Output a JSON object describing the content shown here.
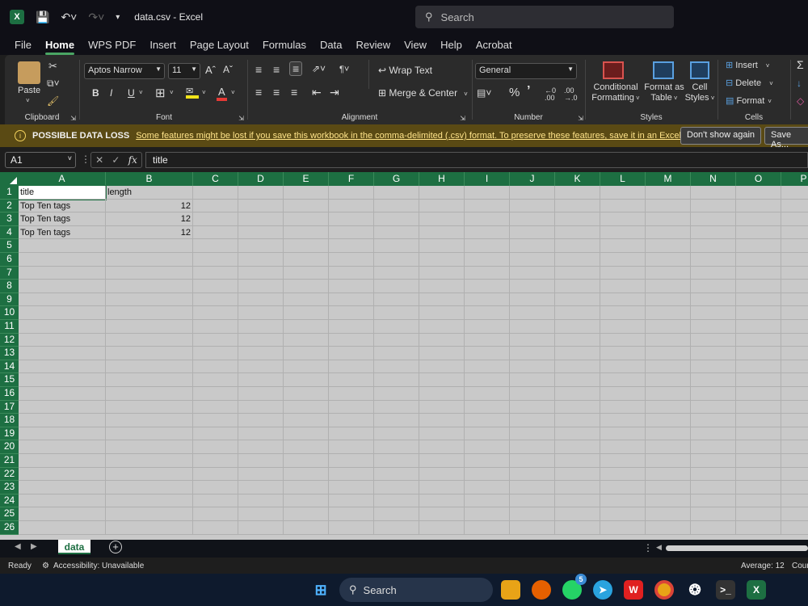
{
  "titlebar": {
    "logo": "X",
    "title": "data.csv  -  Excel",
    "search_placeholder": "Search"
  },
  "menu": [
    "File",
    "Home",
    "WPS PDF",
    "Insert",
    "Page Layout",
    "Formulas",
    "Data",
    "Review",
    "View",
    "Help",
    "Acrobat"
  ],
  "ribbon": {
    "clipboard": {
      "paste": "Paste",
      "label": "Clipboard"
    },
    "font": {
      "name": "Aptos Narrow",
      "size": "11",
      "label": "Font",
      "grow": "Aˆ",
      "shrink": "Aˇ",
      "bold": "B",
      "italic": "I",
      "underline": "U"
    },
    "alignment": {
      "wrap": "Wrap Text",
      "merge": "Merge & Center",
      "label": "Alignment"
    },
    "number": {
      "format": "General",
      "label": "Number"
    },
    "styles": {
      "conditional": [
        "Conditional",
        "Formatting"
      ],
      "format_table": [
        "Format as",
        "Table"
      ],
      "cell_styles": [
        "Cell",
        "Styles"
      ],
      "label": "Styles"
    },
    "cells": {
      "insert": "Insert",
      "delete": "Delete",
      "format": "Format",
      "label": "Cells"
    }
  },
  "infobar": {
    "title": "POSSIBLE DATA LOSS",
    "message": "Some features might be lost if you save this workbook in the comma-delimited (.csv) format. To preserve these features, save it in an Excel file format.",
    "btn_dont_show": "Don't show again",
    "btn_save_as": "Save As..."
  },
  "formula_bar": {
    "name_box": "A1",
    "fx": "fx",
    "value": "title"
  },
  "columns": [
    "A",
    "B",
    "C",
    "D",
    "E",
    "F",
    "G",
    "H",
    "I",
    "J",
    "K",
    "L",
    "M",
    "N",
    "O",
    "P"
  ],
  "rows": [
    "1",
    "2",
    "3",
    "4",
    "5",
    "6",
    "7",
    "8",
    "9",
    "10",
    "11",
    "12",
    "13",
    "14",
    "15",
    "16",
    "17",
    "18",
    "19",
    "20",
    "21",
    "22",
    "23",
    "24",
    "25",
    "26"
  ],
  "cells": [
    {
      "ref": "A1",
      "value": "title"
    },
    {
      "ref": "B1",
      "value": "length"
    },
    {
      "ref": "A2",
      "value": "Top Ten tags"
    },
    {
      "ref": "B2",
      "value": "12"
    },
    {
      "ref": "A3",
      "value": "Top Ten tags"
    },
    {
      "ref": "B3",
      "value": "12"
    },
    {
      "ref": "A4",
      "value": "Top Ten tags"
    },
    {
      "ref": "B4",
      "value": "12"
    }
  ],
  "sheet": {
    "tab": "data"
  },
  "status": {
    "ready": "Ready",
    "accessibility": "Accessibility: Unavailable",
    "average": "Average: 12",
    "count": "Coun"
  },
  "taskbar": {
    "search": "Search",
    "badge": "5"
  }
}
